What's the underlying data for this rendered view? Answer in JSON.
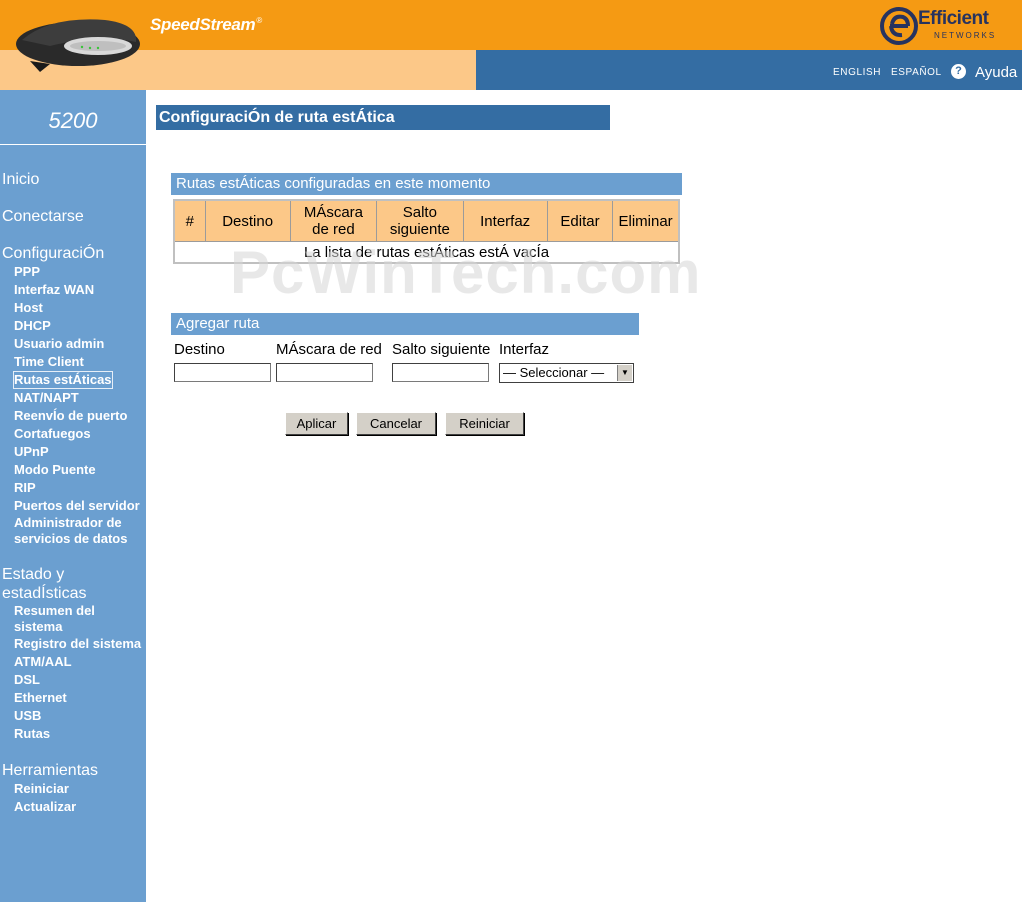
{
  "header": {
    "brand": "SpeedStream",
    "brand_mark": "®",
    "logo_line1": "Efficient",
    "logo_line2": "NETWORKS",
    "lang_english": "ENGLISH",
    "lang_espanol": "ESPAÑOL",
    "help_label": "Ayuda",
    "colors": {
      "orange": "#f59a13",
      "peach": "#fcc888",
      "blue": "#346da3"
    }
  },
  "sidebar": {
    "model": "5200",
    "inicio": "Inicio",
    "conectarse": "Conectarse",
    "configuracion": "ConfiguraciÓn",
    "config_items": [
      "PPP",
      "Interfaz WAN",
      "Host",
      "DHCP",
      "Usuario admin",
      "Time Client",
      "Rutas estÁticas",
      "NAT/NAPT",
      "ReenvÍo de puerto",
      "Cortafuegos",
      "UPnP",
      "Modo Puente",
      "RIP",
      "Puertos del servidor",
      "Administrador de",
      "servicios de datos"
    ],
    "estado_line1": "Estado y",
    "estado_line2": "estadÍsticas",
    "estado_items": [
      "Resumen del",
      "sistema",
      "Registro del sistema",
      "ATM/AAL",
      "DSL",
      "Ethernet",
      "USB",
      "Rutas"
    ],
    "herramientas": "Herramientas",
    "tools_items": [
      "Reiniciar",
      "Actualizar"
    ]
  },
  "main": {
    "page_title": "ConfiguraciÓn de ruta estÁtica",
    "watermark": "PcWinTech.com",
    "routes_section": "Rutas estÁticas configuradas en este momento",
    "columns": {
      "num": "#",
      "destino": "Destino",
      "mascara_1": "MÁscara",
      "mascara_2": "de red",
      "salto_1": "Salto",
      "salto_2": "siguiente",
      "interfaz": "Interfaz",
      "editar": "Editar",
      "eliminar": "Eliminar"
    },
    "empty_message": "La lista de rutas estÁticas estÁ vacÍa",
    "add_section": "Agregar ruta",
    "form": {
      "destino_label": "Destino",
      "mascara_label": "MÁscara de red",
      "salto_label": "Salto siguiente",
      "interfaz_label": "Interfaz",
      "destino_value": "",
      "mascara_value": "",
      "salto_value": "",
      "interfaz_selected": "— Seleccionar —"
    },
    "buttons": {
      "apply": "Aplicar",
      "cancel": "Cancelar",
      "reset": "Reiniciar"
    }
  }
}
